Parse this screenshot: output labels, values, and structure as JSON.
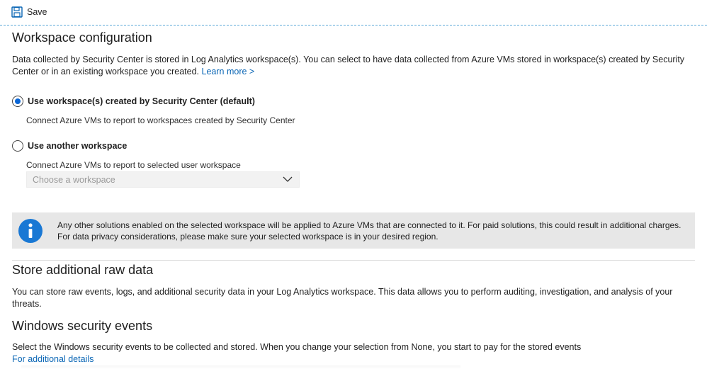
{
  "toolbar": {
    "save_label": "Save",
    "save_icon": "floppy-disk-icon"
  },
  "workspace": {
    "title": "Workspace configuration",
    "description": "Data collected by Security Center is stored in Log Analytics workspace(s). You can select to have data collected from Azure VMs stored in workspace(s) created by Security Center or in an existing workspace you created.",
    "learn_more": "Learn more >",
    "options": [
      {
        "label": "Use workspace(s) created by Security Center (default)",
        "description": "Connect Azure VMs to report to workspaces created by Security Center",
        "selected": true
      },
      {
        "label": "Use another workspace",
        "description": "Connect Azure VMs to report to selected user workspace",
        "selected": false
      }
    ],
    "dropdown_placeholder": "Choose a workspace"
  },
  "info_banner": {
    "icon": "info-icon",
    "text": "Any other solutions enabled on the selected workspace will be applied to Azure VMs that are connected to it. For paid solutions, this could result in additional charges. For data privacy considerations, please make sure your selected workspace is in your desired region."
  },
  "raw_data": {
    "title": "Store additional raw data",
    "description": "You can store raw events, logs, and additional security data in your Log Analytics workspace. This data allows you to perform auditing, investigation, and analysis of your threats."
  },
  "security_events": {
    "title": "Windows security events",
    "description": "Select the Windows security events to be collected and stored. When you change your selection from None, you start to pay for the stored events",
    "details_link": "For additional details"
  },
  "colors": {
    "accent": "#0a66b5",
    "radio_selected": "#0a66d6",
    "info_icon": "#1978d4",
    "banner_bg": "#e7e7e7"
  }
}
